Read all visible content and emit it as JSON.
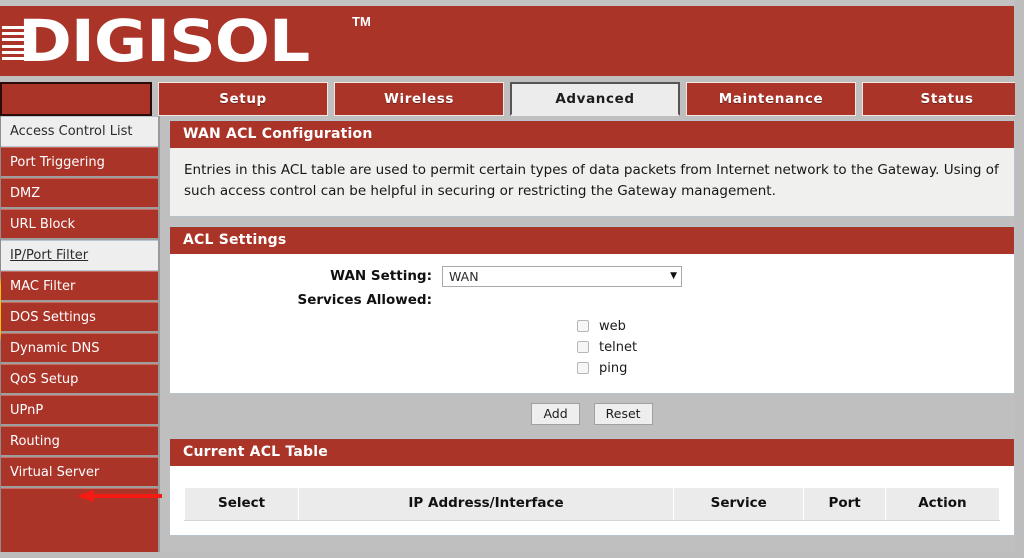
{
  "brand": {
    "name": "DIGISOL",
    "trademark": "TM"
  },
  "tabs": [
    {
      "label": "",
      "state": "blank"
    },
    {
      "label": "Setup",
      "state": "normal"
    },
    {
      "label": "Wireless",
      "state": "normal"
    },
    {
      "label": "Advanced",
      "state": "active"
    },
    {
      "label": "Maintenance",
      "state": "normal"
    },
    {
      "label": "Status",
      "state": "normal"
    },
    {
      "label": "",
      "state": "partial"
    }
  ],
  "sidebar": {
    "items": [
      {
        "label": "Access Control List",
        "state": "selected"
      },
      {
        "label": "Port Triggering",
        "state": "normal"
      },
      {
        "label": "DMZ",
        "state": "normal"
      },
      {
        "label": "URL Block",
        "state": "normal"
      },
      {
        "label": "IP/Port Filter",
        "state": "link"
      },
      {
        "label": "MAC Filter",
        "state": "normal"
      },
      {
        "label": "DOS Settings",
        "state": "normal"
      },
      {
        "label": "Dynamic DNS",
        "state": "normal"
      },
      {
        "label": "QoS Setup",
        "state": "normal"
      },
      {
        "label": "UPnP",
        "state": "normal"
      },
      {
        "label": "Routing",
        "state": "normal"
      },
      {
        "label": "Virtual Server",
        "state": "normal"
      }
    ],
    "annotation_target": "QoS Setup"
  },
  "wan_acl": {
    "title": "WAN ACL Configuration",
    "description": "Entries in this ACL table are used to permit certain types of data packets from Internet network to the Gateway.   Using of such access control can be helpful in securing or restricting the Gateway management."
  },
  "acl_settings": {
    "title": "ACL Settings",
    "wan_setting_label": "WAN Setting:",
    "wan_setting_value": "WAN",
    "services_allowed_label": "Services Allowed:",
    "services": [
      {
        "label": "web",
        "checked": false
      },
      {
        "label": "telnet",
        "checked": false
      },
      {
        "label": "ping",
        "checked": false
      }
    ],
    "add_button": "Add",
    "reset_button": "Reset"
  },
  "current_acl": {
    "title": "Current ACL Table",
    "columns": [
      "Select",
      "IP Address/Interface",
      "Service",
      "Port",
      "Action"
    ],
    "rows": []
  },
  "colors": {
    "brand_red": "#ab3429",
    "panel_bg": "#f0f0ef",
    "page_bg": "#bfbfbf",
    "annotation_red": "#f41b14",
    "cursor_highlight": "#ffc400"
  }
}
